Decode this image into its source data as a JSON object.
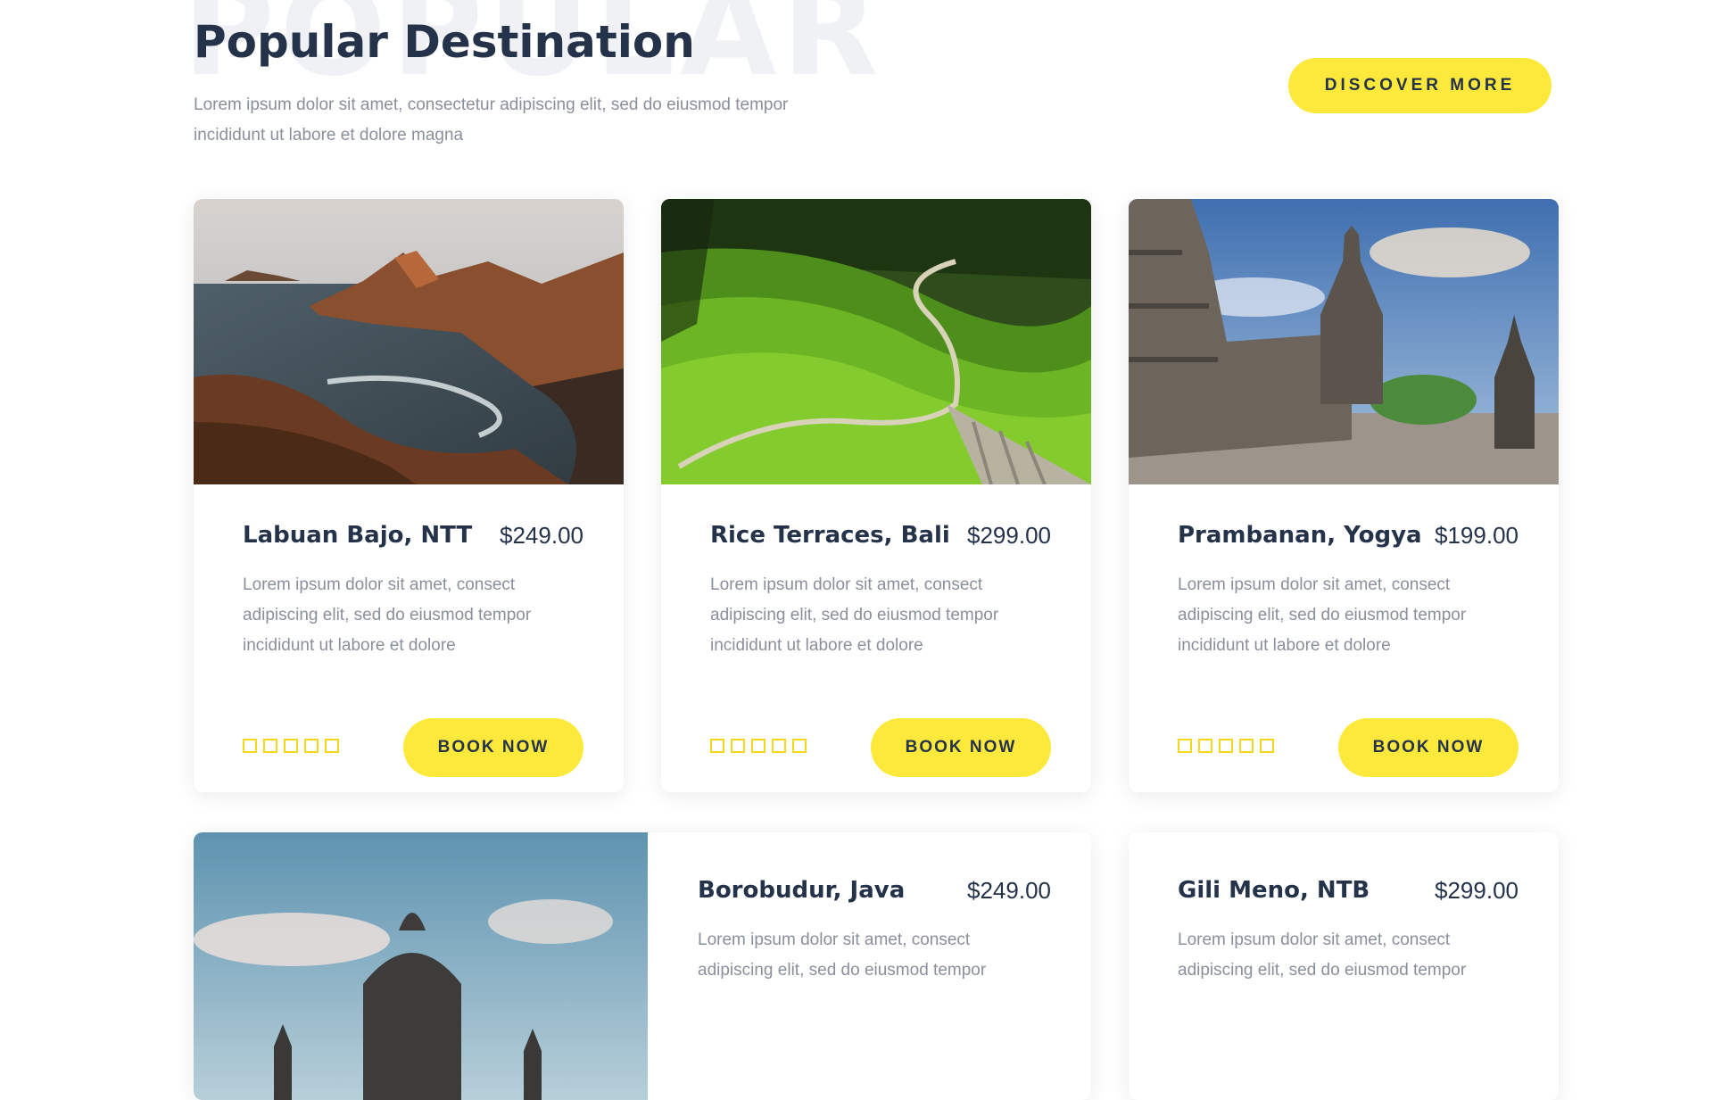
{
  "header": {
    "watermark": "POPULAR",
    "title": "Popular Destination",
    "subtitle": "Lorem ipsum dolor sit amet, consectetur adipiscing elit, sed do eiusmod tempor incididunt ut labore et dolore magna",
    "discover_label": "DISCOVER MORE"
  },
  "destinations": [
    {
      "name": "Labuan Bajo, NTT",
      "price": "$249.00",
      "description": "Lorem ipsum dolor sit amet, consect adipiscing elit, sed do eiusmod tempor incididunt ut labore et dolore",
      "rating": 0,
      "rating_max": 5,
      "book_label": "BOOK NOW",
      "image": "coastal-hills-photo"
    },
    {
      "name": "Rice Terraces, Bali",
      "price": "$299.00",
      "description": "Lorem ipsum dolor sit amet, consect adipiscing elit, sed do eiusmod tempor incididunt ut labore et dolore",
      "rating": 0,
      "rating_max": 5,
      "book_label": "BOOK NOW",
      "image": "rice-terraces-photo"
    },
    {
      "name": "Prambanan, Yogya",
      "price": "$199.00",
      "description": "Lorem ipsum dolor sit amet, consect adipiscing elit, sed do eiusmod tempor incididunt ut labore et dolore",
      "rating": 0,
      "rating_max": 5,
      "book_label": "BOOK NOW",
      "image": "temple-photo"
    },
    {
      "name": "Borobudur, Java",
      "price": "$249.00",
      "description": "Lorem ipsum dolor sit amet, consect adipiscing elit, sed do eiusmod tempor",
      "image": "stupa-photo"
    },
    {
      "name": "Gili Meno, NTB",
      "price": "$299.00",
      "description": "Lorem ipsum dolor sit amet, consect adipiscing elit, sed do eiusmod tempor"
    }
  ],
  "colors": {
    "accent": "#fde93b",
    "heading": "#24324a",
    "muted": "#8a8f9c",
    "star_outline": "#f5d71a"
  }
}
